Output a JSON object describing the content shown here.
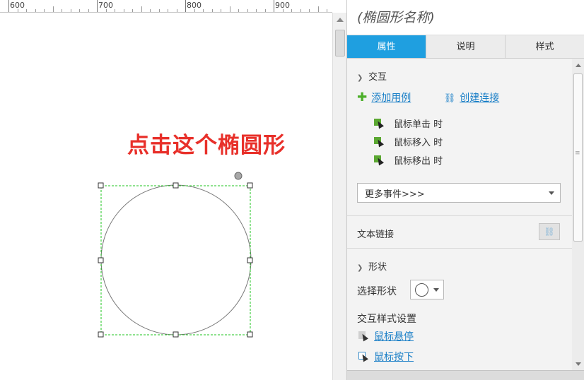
{
  "ruler": {
    "labels": [
      "600",
      "700",
      "800",
      "900"
    ]
  },
  "canvas": {
    "annotation": "点击这个椭圆形"
  },
  "inspector": {
    "shape_name": "(椭圆形名称)",
    "tabs": [
      {
        "label": "属性",
        "active": true
      },
      {
        "label": "说明",
        "active": false
      },
      {
        "label": "样式",
        "active": false
      }
    ],
    "interaction": {
      "title": "交互",
      "add_case": "添加用例",
      "create_link": "创建连接",
      "events": [
        "鼠标单击 时",
        "鼠标移入 时",
        "鼠标移出 时"
      ],
      "more_events": "更多事件>>>"
    },
    "text_link": {
      "label": "文本链接"
    },
    "shape": {
      "title": "形状",
      "select_label": "选择形状",
      "interaction_style_title": "交互样式设置",
      "hover": "鼠标悬停",
      "mousedown": "鼠标按下"
    }
  },
  "colors": {
    "accent": "#1f9fe0",
    "annotation": "#e8302a",
    "selection": "#1fc61f",
    "link": "#1a7fc7"
  }
}
